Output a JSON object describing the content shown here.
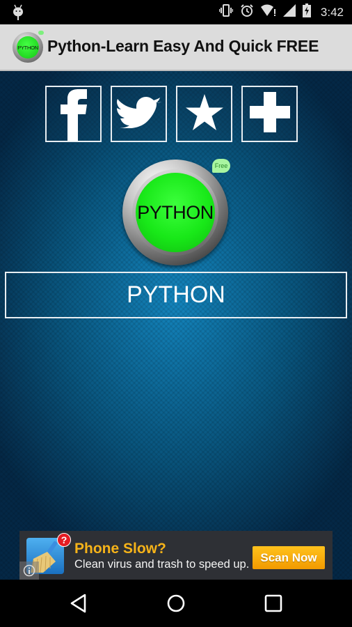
{
  "status_bar": {
    "time": "3:42",
    "icons": [
      "android-debug-icon",
      "vibrate-icon",
      "alarm-icon",
      "wifi-alert-icon",
      "cell-signal-icon",
      "battery-charging-icon"
    ]
  },
  "app_bar": {
    "title": "Python-Learn Easy And Quick FREE",
    "icon_label": "PYTHON"
  },
  "social_buttons": [
    {
      "name": "facebook",
      "icon": "facebook-icon"
    },
    {
      "name": "twitter",
      "icon": "twitter-icon"
    },
    {
      "name": "rate",
      "icon": "star-icon"
    },
    {
      "name": "more",
      "icon": "plus-icon"
    }
  ],
  "main_button": {
    "label": "PYTHON",
    "badge": "Free",
    "color": "#1ee81e"
  },
  "title_box": {
    "label": "PYTHON"
  },
  "ad": {
    "headline": "Phone Slow?",
    "subtext": "Clean virus and trash to speed up.",
    "cta": "Scan Now",
    "badge": "?",
    "headline_color": "#f6b319",
    "cta_color": "#f5a300"
  },
  "nav_bar": {
    "buttons": [
      "back",
      "home",
      "recents"
    ]
  }
}
